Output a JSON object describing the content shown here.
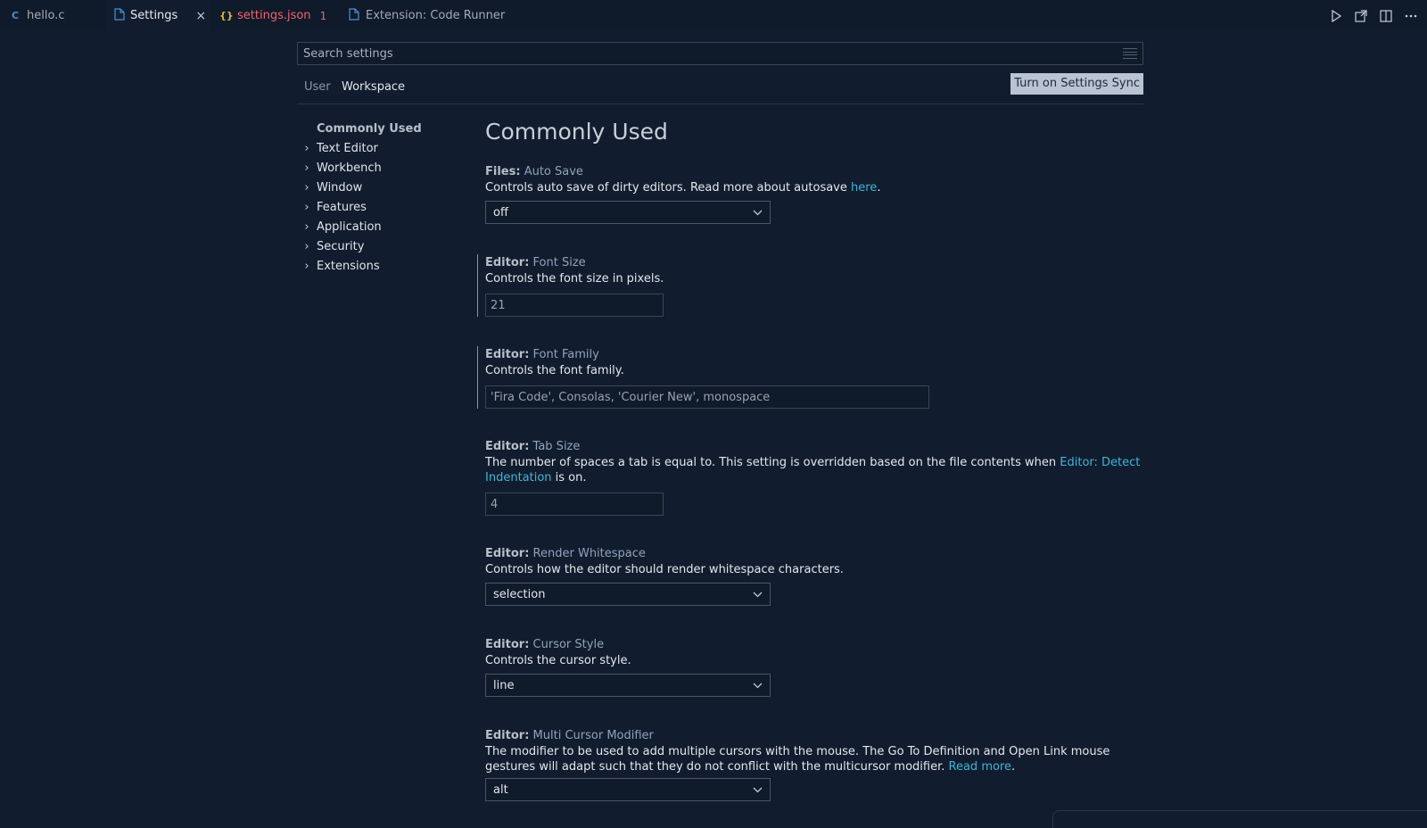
{
  "tabs": [
    {
      "icon": "C",
      "label": "hello.c",
      "active": false
    },
    {
      "icon": "file",
      "label": "Settings",
      "active": true,
      "close": "×"
    },
    {
      "icon": "{}",
      "label": "settings.json",
      "error_count": "1",
      "active": false
    },
    {
      "icon": "file",
      "label": "Extension: Code Runner",
      "active": false
    }
  ],
  "search": {
    "placeholder": "Search settings"
  },
  "scope": {
    "user": "User",
    "workspace": "Workspace",
    "sync_button": "Turn on Settings Sync"
  },
  "toc": {
    "current": "Commonly Used",
    "items": [
      "Text Editor",
      "Workbench",
      "Window",
      "Features",
      "Application",
      "Security",
      "Extensions"
    ]
  },
  "content": {
    "heading": "Commonly Used",
    "settings": [
      {
        "category": "Files:",
        "name": "Auto Save",
        "desc": "Controls auto save of dirty editors. Read more about autosave ",
        "link": "here",
        "desc_after": ".",
        "value": "off"
      },
      {
        "category": "Editor:",
        "name": "Font Size",
        "desc": "Controls the font size in pixels.",
        "value": "21"
      },
      {
        "category": "Editor:",
        "name": "Font Family",
        "desc": "Controls the font family.",
        "value": "'Fira Code', Consolas, 'Courier New', monospace"
      },
      {
        "category": "Editor:",
        "name": "Tab Size",
        "desc": "The number of spaces a tab is equal to. This setting is overridden based on the file contents when ",
        "link": "Editor: Detect Indentation",
        "desc_after": " is on.",
        "value": "4"
      },
      {
        "category": "Editor:",
        "name": "Render Whitespace",
        "desc": "Controls how the editor should render whitespace characters.",
        "value": "selection"
      },
      {
        "category": "Editor:",
        "name": "Cursor Style",
        "desc": "Controls the cursor style.",
        "value": "line"
      },
      {
        "category": "Editor:",
        "name": "Multi Cursor Modifier",
        "desc": "The modifier to be used to add multiple cursors with the mouse. The Go To Definition and Open Link mouse gestures will adapt such that they do not conflict with the multicursor modifier. ",
        "link": "Read more",
        "desc_after": ".",
        "value": "alt"
      }
    ]
  }
}
